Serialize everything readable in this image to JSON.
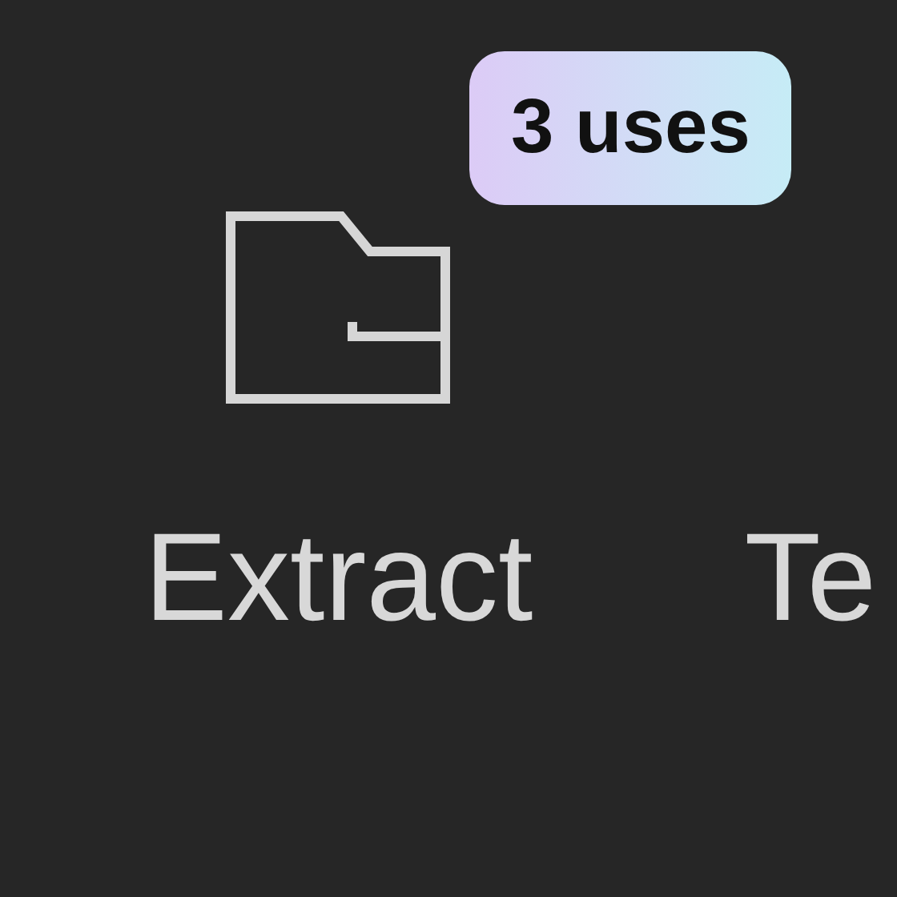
{
  "badge": "3 uses",
  "tool": {
    "label": "Extract"
  },
  "next_tool": {
    "label": "Te"
  }
}
